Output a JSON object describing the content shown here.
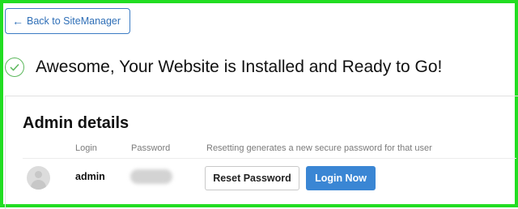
{
  "nav": {
    "back_label": "Back to SiteManager",
    "back_icon": "arrow-left-icon"
  },
  "headline": {
    "icon": "check-circle-icon",
    "text": "Awesome, Your Website is Installed and Ready to Go!"
  },
  "admin": {
    "title": "Admin details",
    "columns": {
      "login": "Login",
      "password": "Password",
      "note": "Resetting generates a new secure password for that user"
    },
    "user": {
      "login": "admin",
      "avatar_icon": "user-avatar-icon"
    },
    "reset_label": "Reset Password",
    "login_now_label": "Login Now"
  },
  "colors": {
    "accent": "#3a86d4",
    "success": "#5cb85c",
    "frame": "#22dd22"
  }
}
